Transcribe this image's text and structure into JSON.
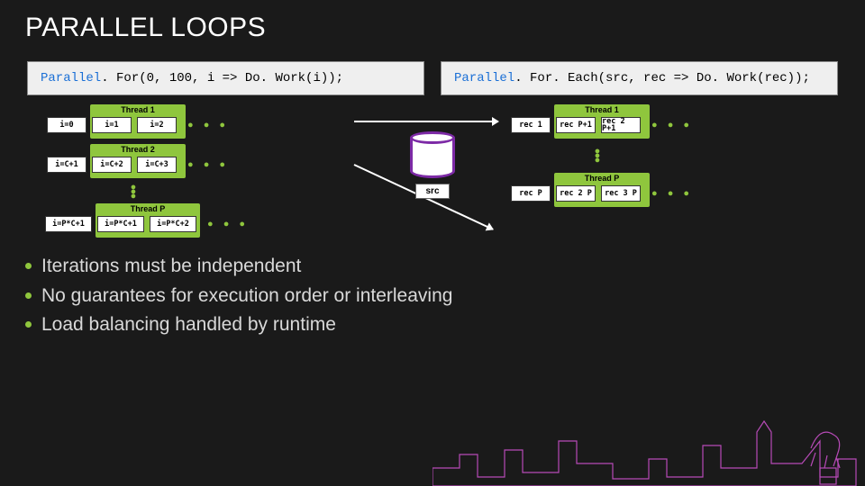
{
  "title": "PARALLEL LOOPS",
  "code_left": {
    "hl": "Parallel",
    "rest": ". For(0, 100, i => Do. Work(i));"
  },
  "code_right": {
    "hl": "Parallel",
    "rest": ". For. Each(src, rec => Do. Work(rec));"
  },
  "left_threads": {
    "t1": {
      "label": "Thread 1",
      "chips": [
        "i=0",
        "i=1",
        "i=2"
      ]
    },
    "t2": {
      "label": "Thread 2",
      "chips": [
        "i=C+1",
        "i=C+2",
        "i=C+3"
      ]
    },
    "tp": {
      "label": "Thread P",
      "chips": [
        "i=P*C+1",
        "i=P*C+1",
        "i=P*C+2"
      ]
    }
  },
  "right_threads": {
    "t1": {
      "label": "Thread 1",
      "chips": [
        "rec 1",
        "rec P+1",
        "rec 2 P+1"
      ]
    },
    "tp": {
      "label": "Thread P",
      "chips": [
        "rec P",
        "rec 2 P",
        "rec 3 P"
      ]
    }
  },
  "src_label": "src",
  "dots": "● ● ●",
  "bullets": [
    "Iterations must be independent",
    "No guarantees for execution order or interleaving",
    "Load balancing handled by runtime"
  ]
}
